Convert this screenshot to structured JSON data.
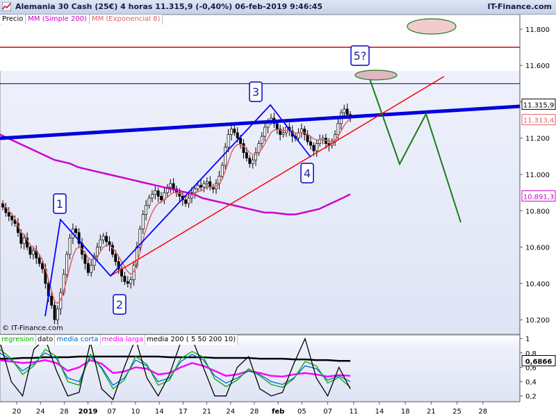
{
  "header": {
    "title": "Alemania 30 Cash (25€)   4 horas    11.315,9 (-0,40%)    06-feb-2019 9:46:45",
    "brand": "IT-Finance.com"
  },
  "legend": {
    "price": "Precio",
    "sma": "MM (Simple 200)",
    "ema": "MM (Exponencial 8)"
  },
  "copyright": "© IT-Finance.com",
  "lower_legend": {
    "regresion": "regresion",
    "dato": "dato",
    "media_corta": "media corta",
    "media_larga": "media larga",
    "media200": "media 200 ( 5 50 200 10)"
  },
  "colors": {
    "candle_up": "#ffffff",
    "candle_down": "#000000",
    "sma": "#cc00cc",
    "ema": "#e06060",
    "wave_lines": "#0000ff",
    "trendline_red": "#ff0000",
    "thick_channel": "#0000dd",
    "projection": "#1a7a1a",
    "hline_red": "#cc0000",
    "hline_blue": "#000080",
    "label_box": "#0000cc"
  },
  "chart_data": [
    {
      "type": "candlestick",
      "title": "Alemania 30 Cash (25€) 4 horas",
      "last_price": "11.315,9",
      "change": "(-0,40%)",
      "timestamp": "06-feb-2019 9:46:45",
      "x_ticks": [
        "20",
        "24",
        "28",
        "2019",
        "07",
        "10",
        "14",
        "17",
        "21",
        "24",
        "28",
        "feb",
        "05",
        "07",
        "11",
        "14",
        "18",
        "21",
        "25",
        "28"
      ],
      "y_ticks": [
        "11.800",
        "11.600",
        "11.400",
        "11.200",
        "11.000",
        "10.800",
        "10.600",
        "10.400",
        "10.200"
      ],
      "ylim": [
        10120,
        11880
      ],
      "price_labels": {
        "last": "11.315,9",
        "ema": "11.313,4",
        "sma": "10.891,3"
      },
      "horizontal_lines": [
        11700,
        11500
      ],
      "wave_labels": [
        "1",
        "2",
        "3",
        "4",
        "5?"
      ],
      "wave_points": [
        {
          "label": "1",
          "x": 87,
          "price": 10700
        },
        {
          "label": "2",
          "x": 159,
          "price": 10400
        },
        {
          "label": "3",
          "x": 389,
          "price": 11310
        },
        {
          "label": "4",
          "x": 447,
          "price": 11050
        }
      ],
      "close_series": [
        10820,
        10790,
        10770,
        10750,
        10730,
        10680,
        10620,
        10650,
        10600,
        10560,
        10580,
        10540,
        10510,
        10480,
        10400,
        10330,
        10280,
        10200,
        10260,
        10350,
        10450,
        10560,
        10650,
        10700,
        10680,
        10620,
        10560,
        10510,
        10460,
        10500,
        10550,
        10600,
        10640,
        10660,
        10630,
        10610,
        10560,
        10520,
        10480,
        10440,
        10410,
        10400,
        10420,
        10500,
        10600,
        10700,
        10780,
        10830,
        10870,
        10890,
        10910,
        10880,
        10860,
        10900,
        10930,
        10950,
        10920,
        10900,
        10880,
        10860,
        10840,
        10870,
        10900,
        10920,
        10940,
        10930,
        10950,
        10960,
        10930,
        10920,
        10950,
        10990,
        11050,
        11150,
        11220,
        11250,
        11230,
        11200,
        11170,
        11120,
        11090,
        11060,
        11080,
        11120,
        11170,
        11210,
        11260,
        11290,
        11310,
        11280,
        11250,
        11220,
        11230,
        11260,
        11240,
        11210,
        11200,
        11230,
        11250,
        11220,
        11180,
        11160,
        11130,
        11170,
        11190,
        11200,
        11170,
        11160,
        11180,
        11220,
        11280,
        11340,
        11360,
        11330,
        11316
      ],
      "ema8_series": [
        10850,
        10820,
        10800,
        10780,
        10760,
        10720,
        10680,
        10670,
        10640,
        10610,
        10600,
        10580,
        10560,
        10530,
        10480,
        10420,
        10360,
        10300,
        10290,
        10310,
        10360,
        10420,
        10490,
        10550,
        10590,
        10600,
        10590,
        10570,
        10540,
        10530,
        10535,
        10550,
        10575,
        10600,
        10610,
        10610,
        10595,
        10575,
        10550,
        10520,
        10490,
        10465,
        10450,
        10465,
        10510,
        10570,
        10640,
        10700,
        10750,
        10790,
        10820,
        10840,
        10850,
        10860,
        10875,
        10890,
        10900,
        10900,
        10895,
        10890,
        10880,
        10880,
        10885,
        10895,
        10905,
        10910,
        10920,
        10930,
        10930,
        10930,
        10935,
        10950,
        10975,
        11020,
        11070,
        11120,
        11150,
        11165,
        11165,
        11155,
        11140,
        11120,
        11110,
        11110,
        11120,
        11140,
        11170,
        11200,
        11230,
        11245,
        11248,
        11245,
        11240,
        11243,
        11242,
        11235,
        11228,
        11228,
        11232,
        11230,
        11220,
        11210,
        11195,
        11190,
        11190,
        11192,
        11188,
        11183,
        11182,
        11190,
        11210,
        11240,
        11270,
        11290,
        11313
      ],
      "sma200_series": [
        11220,
        11200,
        11180,
        11160,
        11140,
        11120,
        11100,
        11080,
        11070,
        11060,
        11040,
        11030,
        11020,
        11010,
        11000,
        10990,
        10980,
        10970,
        10960,
        10950,
        10940,
        10930,
        10920,
        10910,
        10900,
        10890,
        10870,
        10860,
        10850,
        10840,
        10830,
        10820,
        10810,
        10800,
        10790,
        10790,
        10785,
        10780,
        10780,
        10790,
        10800,
        10810,
        10830,
        10850,
        10870,
        10891
      ]
    },
    {
      "type": "line",
      "title": "regresion / dato / media corta / media larga / media 200",
      "y_ticks": [
        "1",
        "0,8",
        "0,6",
        "0,4",
        "0,2"
      ],
      "ylim": [
        0.12,
        1.05
      ],
      "last_value": "0,6866",
      "series": [
        {
          "name": "media 200",
          "color": "#000000",
          "values": [
            0.72,
            0.72,
            0.73,
            0.73,
            0.74,
            0.74,
            0.74,
            0.75,
            0.75,
            0.75,
            0.75,
            0.75,
            0.75,
            0.75,
            0.75,
            0.74,
            0.74,
            0.74,
            0.74,
            0.73,
            0.73,
            0.73,
            0.73,
            0.72,
            0.72,
            0.72,
            0.71,
            0.71,
            0.7,
            0.7,
            0.69,
            0.69
          ]
        },
        {
          "name": "media larga",
          "color": "#ff00ff",
          "values": [
            0.7,
            0.68,
            0.66,
            0.67,
            0.7,
            0.66,
            0.55,
            0.6,
            0.7,
            0.65,
            0.52,
            0.54,
            0.6,
            0.58,
            0.5,
            0.52,
            0.6,
            0.66,
            0.62,
            0.55,
            0.48,
            0.5,
            0.55,
            0.52,
            0.48,
            0.47,
            0.5,
            0.52,
            0.5,
            0.47,
            0.49,
            0.48
          ]
        },
        {
          "name": "media corta",
          "color": "#0066cc",
          "values": [
            0.8,
            0.7,
            0.55,
            0.65,
            0.8,
            0.72,
            0.45,
            0.4,
            0.75,
            0.6,
            0.35,
            0.45,
            0.7,
            0.62,
            0.4,
            0.45,
            0.68,
            0.78,
            0.7,
            0.48,
            0.38,
            0.45,
            0.55,
            0.5,
            0.4,
            0.36,
            0.45,
            0.62,
            0.58,
            0.42,
            0.48,
            0.4
          ]
        },
        {
          "name": "regresion",
          "color": "#00aa00",
          "values": [
            0.85,
            0.72,
            0.5,
            0.62,
            0.85,
            0.75,
            0.4,
            0.35,
            0.78,
            0.58,
            0.3,
            0.42,
            0.75,
            0.64,
            0.35,
            0.42,
            0.72,
            0.82,
            0.74,
            0.44,
            0.33,
            0.42,
            0.58,
            0.48,
            0.36,
            0.32,
            0.44,
            0.68,
            0.62,
            0.38,
            0.46,
            0.32
          ]
        },
        {
          "name": "dato",
          "color": "#000000",
          "values": [
            0.95,
            0.4,
            0.2,
            0.85,
            1.0,
            0.55,
            0.2,
            0.25,
            0.95,
            0.3,
            0.15,
            0.6,
            1.0,
            0.45,
            0.2,
            0.5,
            0.95,
            1.0,
            0.6,
            0.2,
            0.2,
            0.6,
            0.75,
            0.3,
            0.2,
            0.25,
            0.65,
            1.0,
            0.45,
            0.2,
            0.6,
            0.3
          ]
        }
      ]
    }
  ]
}
